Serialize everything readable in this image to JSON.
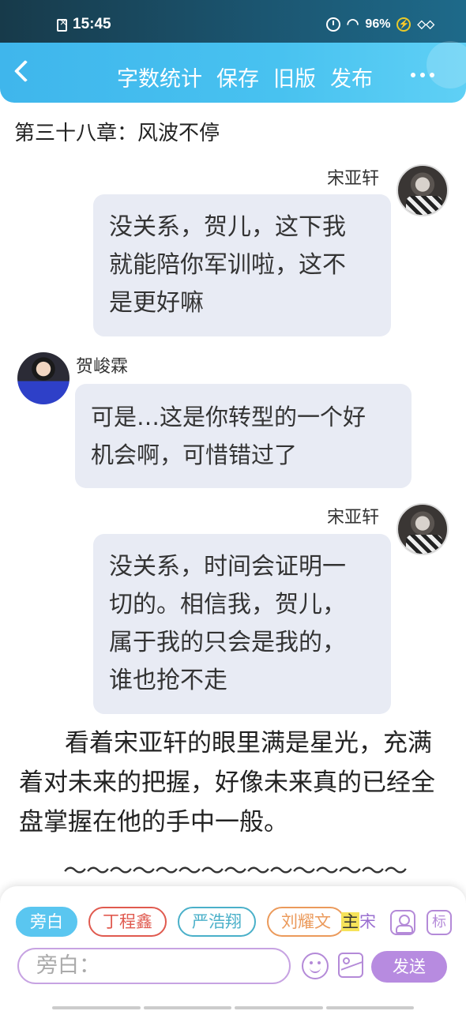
{
  "status_bar": {
    "time": "15:45",
    "battery": "96%"
  },
  "header": {
    "actions": [
      "字数统计",
      "保存",
      "旧版",
      "发布"
    ]
  },
  "chapter_title": "第三十八章：风波不停",
  "messages": [
    {
      "speaker": "宋亚轩",
      "side": "right",
      "text_lines": [
        "没关系，贺儿，这下我",
        "就能陪你军训啦，这不",
        "是更好嘛"
      ]
    },
    {
      "speaker": "贺峻霖",
      "side": "left",
      "text_lines": [
        "可是…这是你转型的一个好",
        "机会啊，可惜错过了"
      ]
    },
    {
      "speaker": "宋亚轩",
      "side": "right",
      "text_lines": [
        "没关系，时间会证明一",
        "切的。相信我，贺儿，",
        "属于我的只会是我的，",
        "谁也抢不走"
      ]
    }
  ],
  "narration": "看着宋亚轩的眼里满是星光，充满着对未来的把握，好像未来真的已经全盘掌握在他的手中一般。",
  "separator": "〜〜〜〜〜〜〜〜〜〜〜〜〜〜〜",
  "roles": [
    "旁白",
    "丁程鑫",
    "严浩翔",
    "刘耀文"
  ],
  "role_extra": {
    "zhu": "主",
    "song": "宋"
  },
  "tag_label": "标",
  "input": {
    "placeholder": "旁白："
  },
  "send_label": "发送"
}
